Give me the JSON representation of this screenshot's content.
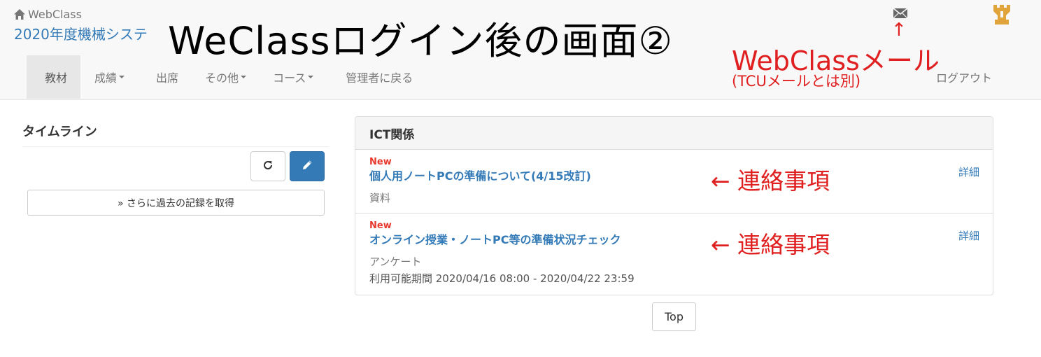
{
  "header": {
    "brand": "WebClass",
    "course_title": "2020年度機械システ",
    "overlay_title": "WeClassログイン後の画面②",
    "mail_arrow": "↑",
    "mail_annotation": "WebClassメール",
    "mail_annotation_sub": "(TCUメールとは別)",
    "logout": "ログアウト"
  },
  "nav": {
    "items": [
      {
        "label": "教材"
      },
      {
        "label": "成績"
      },
      {
        "label": "出席"
      },
      {
        "label": "その他"
      },
      {
        "label": "コース"
      },
      {
        "label": "管理者に戻る"
      }
    ]
  },
  "timeline": {
    "title": "タイムライン",
    "more_label": "» さらに過去の記録を取得"
  },
  "panel": {
    "heading": "ICT関係",
    "items": [
      {
        "badge": "New",
        "title": "個人用ノートPCの準備について(4/15改訂)",
        "type": "資料",
        "detail": "詳細",
        "annotation": "← 連絡事項"
      },
      {
        "badge": "New",
        "title": "オンライン授業・ノートPC等の準備状況チェック",
        "type": "アンケート",
        "period": "利用可能期間 2020/04/16 08:00 - 2020/04/22 23:59",
        "detail": "詳細",
        "annotation": "← 連絡事項"
      }
    ]
  },
  "footer": {
    "top_label": "Top"
  },
  "colors": {
    "link": "#337ab7",
    "primary": "#337ab7",
    "annotation": "#e02020",
    "new_badge": "#e8382e",
    "logo": "#e0a43a"
  }
}
